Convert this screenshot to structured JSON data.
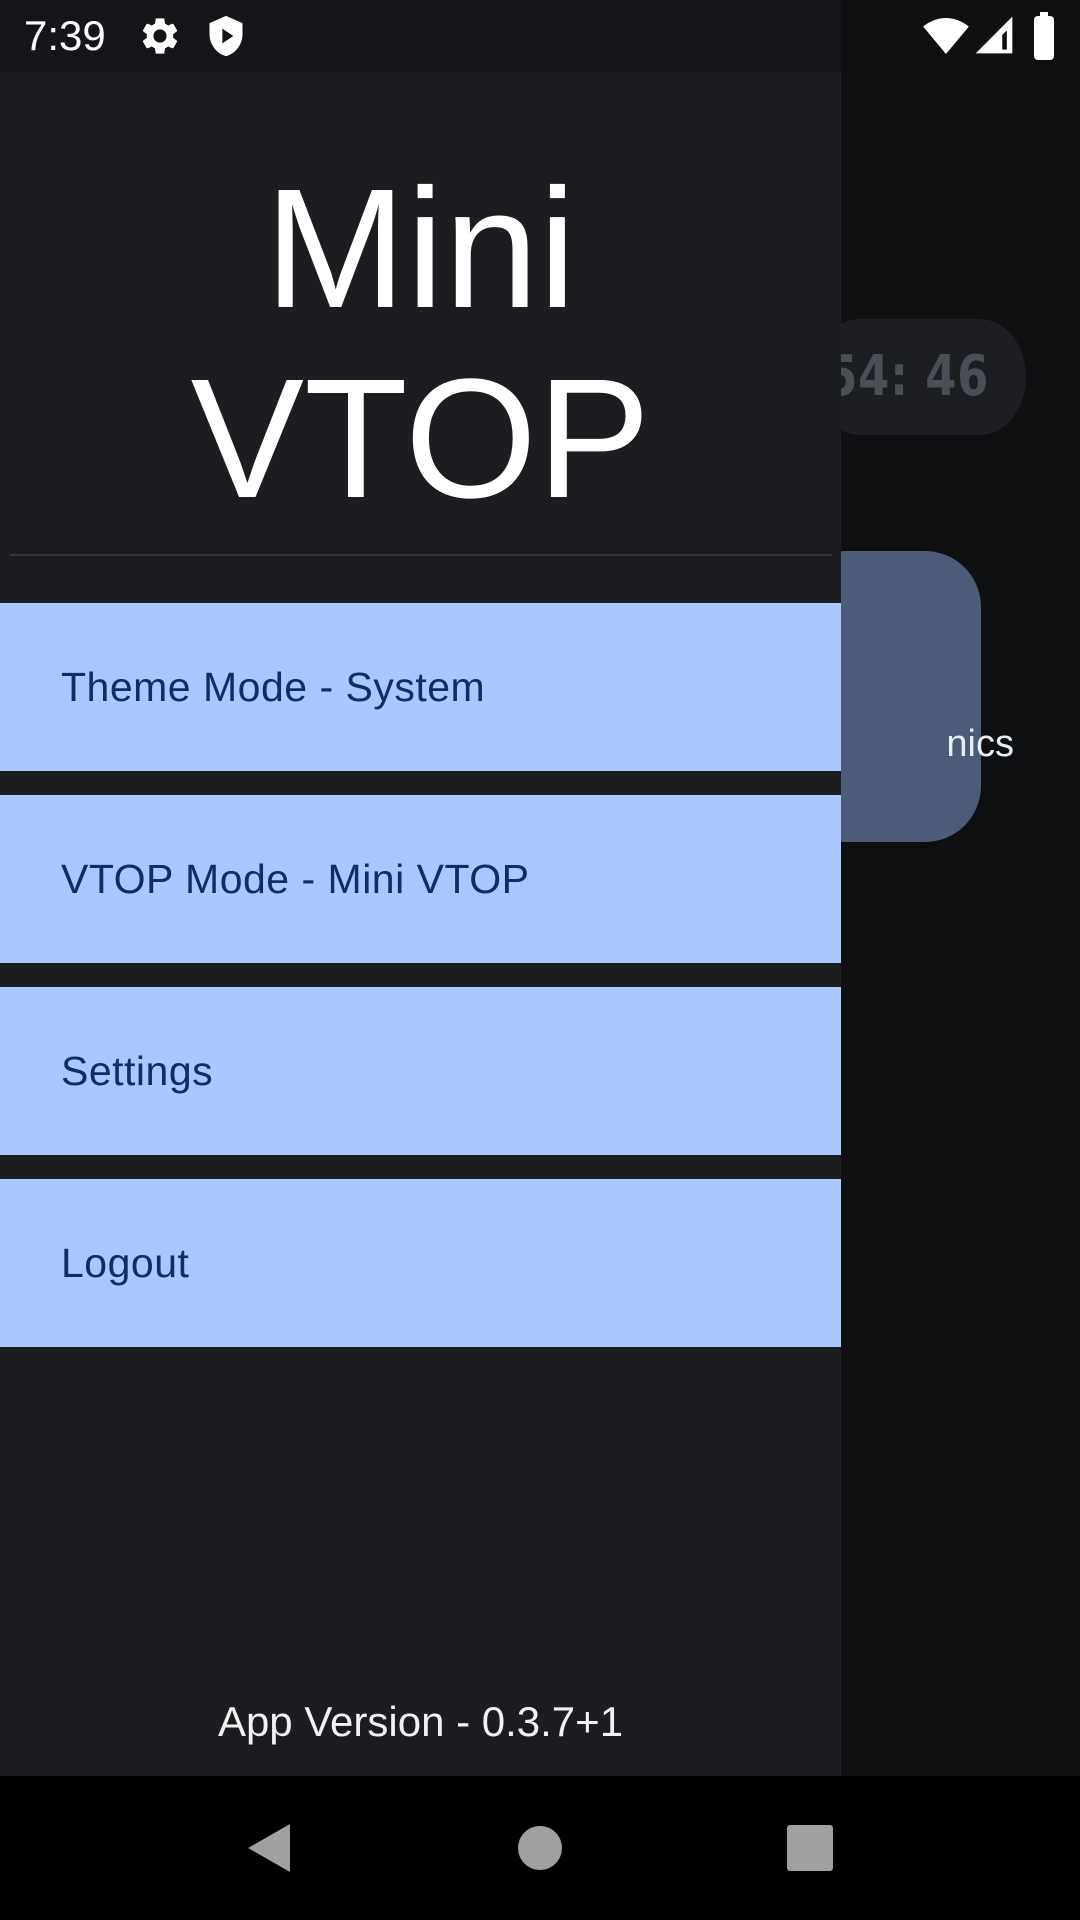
{
  "status_bar": {
    "time": "7:39",
    "icons": [
      "gear-icon",
      "shield-play-icon",
      "wifi-icon",
      "cellular-signal-icon",
      "battery-icon"
    ]
  },
  "background": {
    "timer_text": "54: 46",
    "card_label_fragment": "nics"
  },
  "drawer": {
    "title_line1": "Mini",
    "title_line2": "VTOP",
    "items": [
      {
        "label": "Theme Mode - System"
      },
      {
        "label": "VTOP Mode - Mini VTOP"
      },
      {
        "label": "Settings"
      },
      {
        "label": "Logout"
      }
    ],
    "app_version": "App Version - 0.3.7+1"
  },
  "nav_bar": {
    "buttons": [
      "back-icon",
      "home-icon",
      "recents-icon"
    ]
  },
  "colors": {
    "drawer_bg": "#1c1d21",
    "menu_item_bg": "#a8c8ff",
    "menu_item_text": "#0a2f6b",
    "card_bg": "#4c5b77"
  }
}
